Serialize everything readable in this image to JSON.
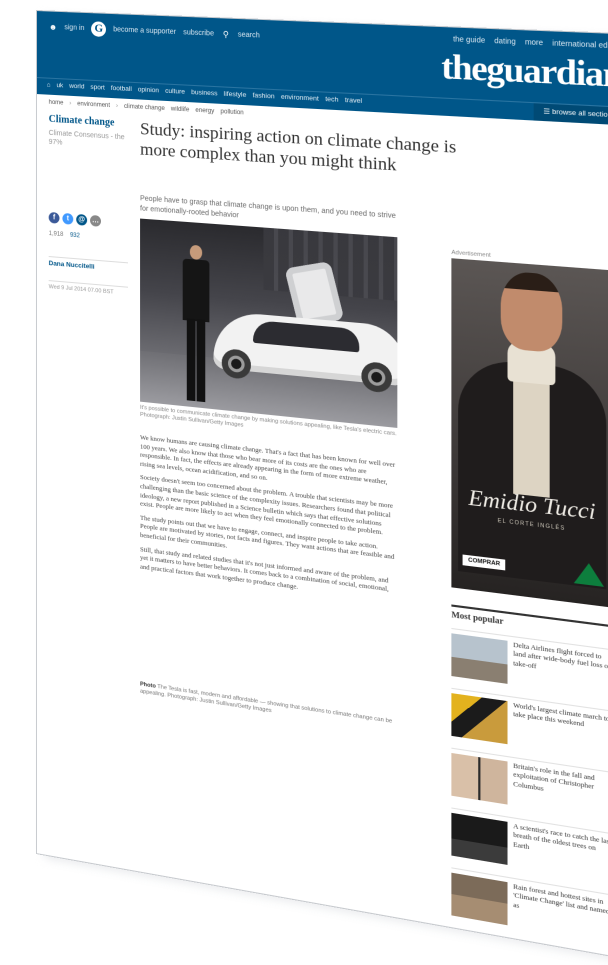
{
  "header": {
    "topbar_left": [
      {
        "icon": "user-icon",
        "label": "sign in"
      },
      {
        "icon": "guardian-g-icon",
        "label": "become a supporter"
      },
      {
        "icon": "",
        "label": "subscribe"
      },
      {
        "icon": "search-icon",
        "label": "search"
      }
    ],
    "topbar_right": [
      "the guide",
      "dating",
      "more",
      "international edition"
    ],
    "logo": "theguardian",
    "nav_items": [
      "home",
      "uk",
      "world",
      "sport",
      "football",
      "opinion",
      "culture",
      "business",
      "lifestyle",
      "fashion",
      "environment",
      "tech",
      "travel"
    ],
    "browse_label": "browse all sections"
  },
  "breadcrumb": {
    "items": [
      "home",
      "environment",
      "climate change"
    ],
    "tags": [
      "wildlife",
      "energy",
      "pollution"
    ]
  },
  "series": {
    "title": "Climate change",
    "subtitle": "Climate Consensus - the 97%"
  },
  "share": {
    "shares_count": "1,918",
    "comments_count": "932",
    "author": "Dana Nuccitelli",
    "dateline": "Wed 9 Jul 2014 07.00 BST"
  },
  "article": {
    "headline": "Study: inspiring action on climate change is more complex than you might think",
    "standfirst": "People have to grasp that climate change is upon them, and you need to strive for emotionally-rooted behavior",
    "hero_caption": "It's possible to communicate climate change by making solutions appealing, like Tesla's electric cars. Photograph: Justin Sullivan/Getty Images",
    "paragraphs": [
      "We know humans are causing climate change. That's a fact that has been known for well over 100 years. We also know that those who bear more of its costs are the ones who are responsible. In fact, the effects are already appearing in the form of more extreme weather, rising sea levels, ocean acidification, and so on.",
      "Society doesn't seem too concerned about the problem. A trouble that scientists may be more challenging than the basic science of the complexity issues. Researchers found that political ideology, a new report published in a Science bulletin which says that effective solutions exist. People are more likely to act when they feel emotionally connected to the problem.",
      "The study points out that we have to engage, connect, and inspire people to take action. People are motivated by stories, not facts and figures. They want actions that are feasible and beneficial for their communities.",
      "Still, that study and related studies that it's not just informed and aware of the problem, and yet it matters to have better behaviors. It comes back to a combination of social, emotional, and practical factors that work together to produce change."
    ],
    "photo_credit_label": "Photo",
    "photo_credit": "The Tesla is fast, modern and affordable — showing that solutions to climate change can be appealing. Photograph: Justin Sullivan/Getty Images"
  },
  "ad": {
    "label": "Advertisement",
    "brand": "Emidio Tucci",
    "brand_sub": "EL CORTE INGLÉS",
    "cta": "COMPRAR"
  },
  "most_popular": {
    "title": "Most popular",
    "items": [
      {
        "text": "Delta Airlines flight forced to land after wide-body fuel loss on take-off"
      },
      {
        "text": "World's largest climate march to take place this weekend"
      },
      {
        "text": "Britain's role in the fall and exploitation of Christopher Columbus"
      },
      {
        "text": "A scientist's race to catch the last breath of the oldest trees on Earth"
      },
      {
        "text": "Rain forest and hottest sites in 'Climate Change' list and named as"
      }
    ]
  }
}
